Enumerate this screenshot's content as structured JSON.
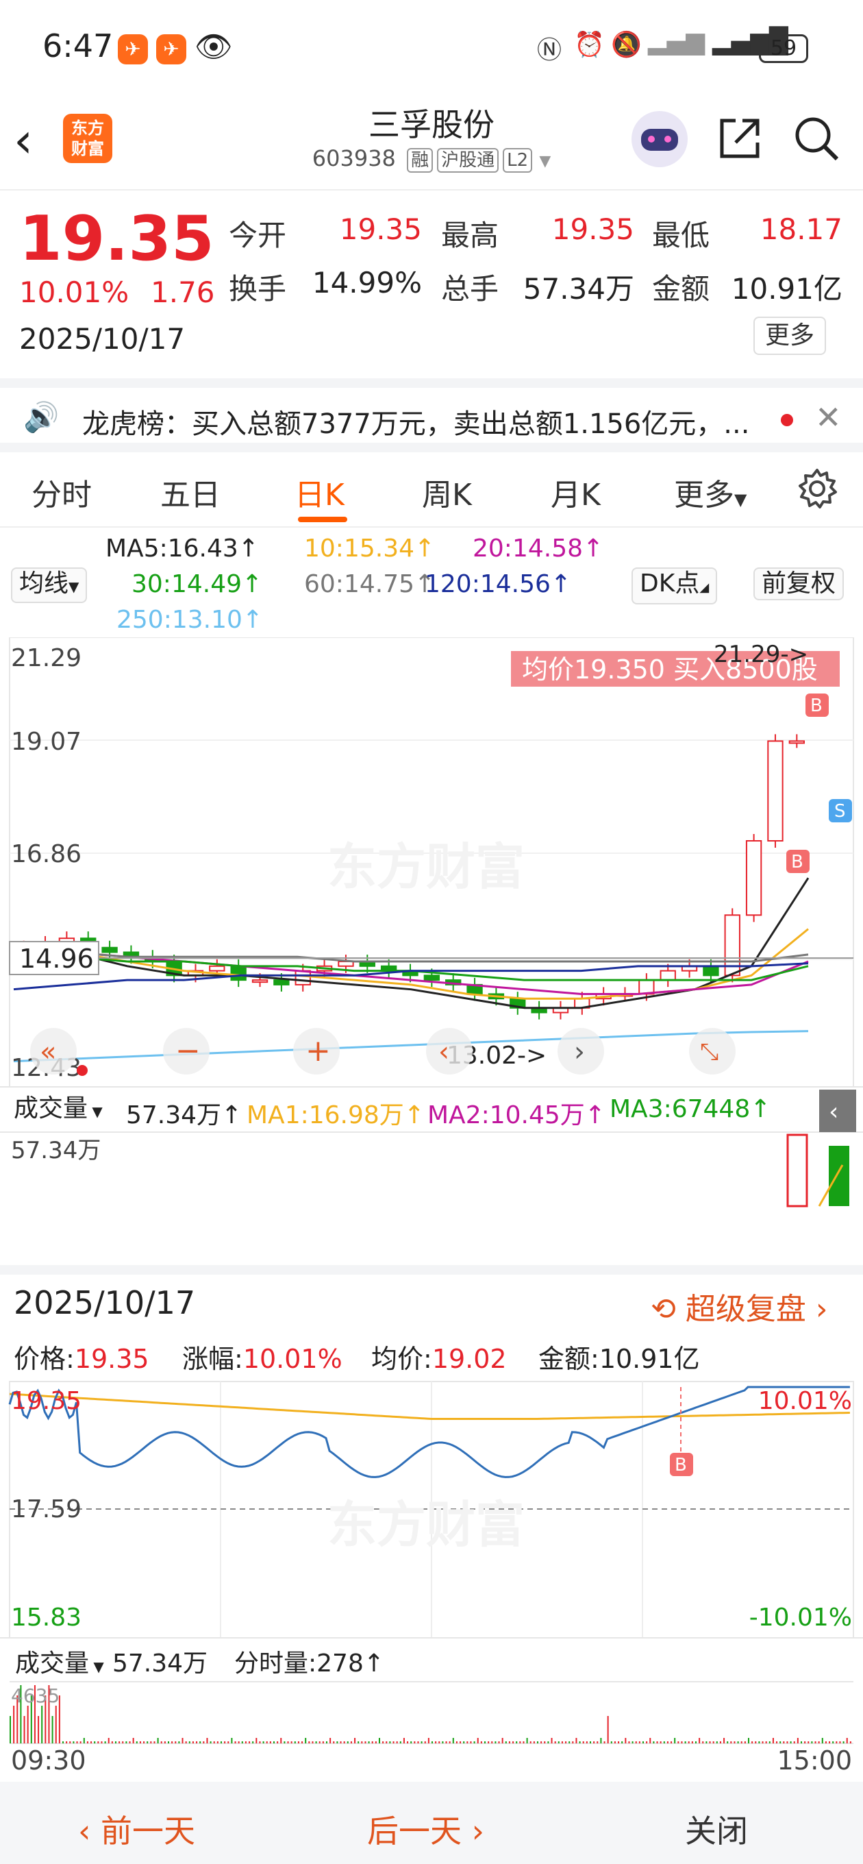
{
  "status": {
    "time": "6:47",
    "battery": "59"
  },
  "header": {
    "back_icon": "chevron-left-icon",
    "logo_line1": "东方",
    "logo_line2": "财富",
    "title": "三孚股份",
    "code": "603938",
    "tags": [
      "融",
      "沪股通",
      "L2"
    ],
    "icons": [
      "robot-assistant-icon",
      "share-icon",
      "search-icon"
    ]
  },
  "quote": {
    "price": "19.35",
    "change_pct": "10.01%",
    "change": "1.76",
    "date": "2025/10/17",
    "open_label": "今开",
    "open": "19.35",
    "high_label": "最高",
    "high": "19.35",
    "low_label": "最低",
    "low": "18.17",
    "turnover_label": "换手",
    "turnover": "14.99%",
    "volume_label": "总手",
    "volume": "57.34万",
    "amount_label": "金额",
    "amount": "10.91亿",
    "more": "更多"
  },
  "news": {
    "text": "龙虎榜：买入总额7377万元，卖出总额1.156亿元，...",
    "icon": "speaker-icon"
  },
  "tabs": {
    "items": [
      "分时",
      "五日",
      "日K",
      "周K",
      "月K",
      "更多"
    ],
    "active": "日K"
  },
  "ma_legend": {
    "selector": "均线",
    "ma5": "MA5:16.43↑",
    "ma10": "10:15.34↑",
    "ma20": "20:14.58↑",
    "ma30": "30:14.49↑",
    "ma60": "60:14.75↑",
    "ma120": "120:14.56↑",
    "ma250": "250:13.10↑",
    "dk": "DK点",
    "fq": "前复权"
  },
  "kchart": {
    "y_labels": [
      "21.29",
      "19.07",
      "16.86",
      "12.43"
    ],
    "current_marker": "14.96",
    "high_marker": "21.29->",
    "low_marker": "13.02->",
    "trade_tooltip": "均价19.350  买入8500股",
    "watermark": "东方财富",
    "colors": {
      "up": "#e6232b",
      "down": "#16a015",
      "ma5": "#222222",
      "ma10": "#f2b01e",
      "ma20": "#c0169c",
      "ma30": "#16a015",
      "ma60": "#777777",
      "ma120": "#1a2e9a",
      "ma250": "#6cc0ef"
    }
  },
  "volume_panel": {
    "selector": "成交量",
    "value": "57.34万↑",
    "ma1": "MA1:16.98万↑",
    "ma2": "MA2:10.45万↑",
    "ma3": "MA3:67448↑",
    "y_label": "57.34万"
  },
  "intraday": {
    "date": "2025/10/17",
    "replay": "超级复盘",
    "price_label": "价格:",
    "price": "19.35",
    "chg_label": "涨幅:",
    "chg": "10.01%",
    "avg_label": "均价:",
    "avg": "19.02",
    "amt_label": "金额:",
    "amt": "10.91亿",
    "y_top": "19.35",
    "y_mid": "17.59",
    "y_bottom": "15.83",
    "pct_top": "10.01%",
    "pct_bottom": "-10.01%",
    "vol_selector": "成交量",
    "vol_value": "57.34万",
    "tick_label": "分时量:278↑",
    "vol_axis": "4635",
    "time_start": "09:30",
    "time_end": "15:00"
  },
  "bottom": {
    "prev": "前一天",
    "next": "后一天",
    "close": "关闭"
  }
}
